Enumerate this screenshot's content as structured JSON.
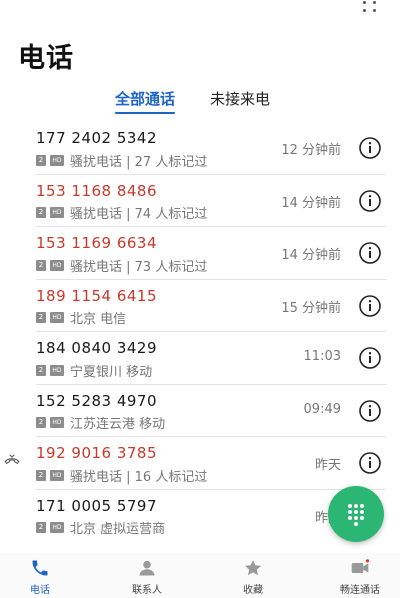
{
  "header": {
    "title": "电话"
  },
  "tabs": [
    {
      "label": "全部通话",
      "active": true
    },
    {
      "label": "未接来电",
      "active": false
    }
  ],
  "calls": [
    {
      "number": "177 2402 5342",
      "missed": false,
      "sim": "2",
      "detail": "骚扰电话 | 27 人标记过",
      "time": "12 分钟前"
    },
    {
      "number": "153 1168 8486",
      "missed": true,
      "sim": "2",
      "detail": "骚扰电话 | 74 人标记过",
      "time": "14 分钟前"
    },
    {
      "number": "153 1169 6634",
      "missed": true,
      "sim": "2",
      "detail": "骚扰电话 | 73 人标记过",
      "time": "14 分钟前"
    },
    {
      "number": "189 1154 6415",
      "missed": true,
      "sim": "2",
      "detail": "北京 电信",
      "time": "15 分钟前"
    },
    {
      "number": "184 0840 3429",
      "missed": false,
      "sim": "2",
      "detail": "宁夏银川 移动",
      "time": "11:03"
    },
    {
      "number": "152 5283 4970",
      "missed": false,
      "sim": "2",
      "detail": "江苏连云港 移动",
      "time": "09:49"
    },
    {
      "number": "192 9016 3785",
      "missed": true,
      "sim": "2",
      "detail": "骚扰电话 | 16 人标记过",
      "time": "昨天"
    },
    {
      "number": "171 0005 5797",
      "missed": false,
      "sim": "2",
      "detail": "北京 虚拟运营商",
      "time": "昨天"
    }
  ],
  "badges": {
    "hd": "HD"
  },
  "bottom_nav": [
    {
      "label": "电话",
      "icon": "phone-icon",
      "active": true
    },
    {
      "label": "联系人",
      "icon": "person-icon",
      "active": false
    },
    {
      "label": "收藏",
      "icon": "star-icon",
      "active": false
    },
    {
      "label": "畅连通话",
      "icon": "video-call-icon",
      "active": false
    }
  ],
  "colors": {
    "accent": "#1f63c8",
    "missed": "#c63a2a",
    "fab": "#2bb673",
    "secondary_text": "#777777"
  }
}
